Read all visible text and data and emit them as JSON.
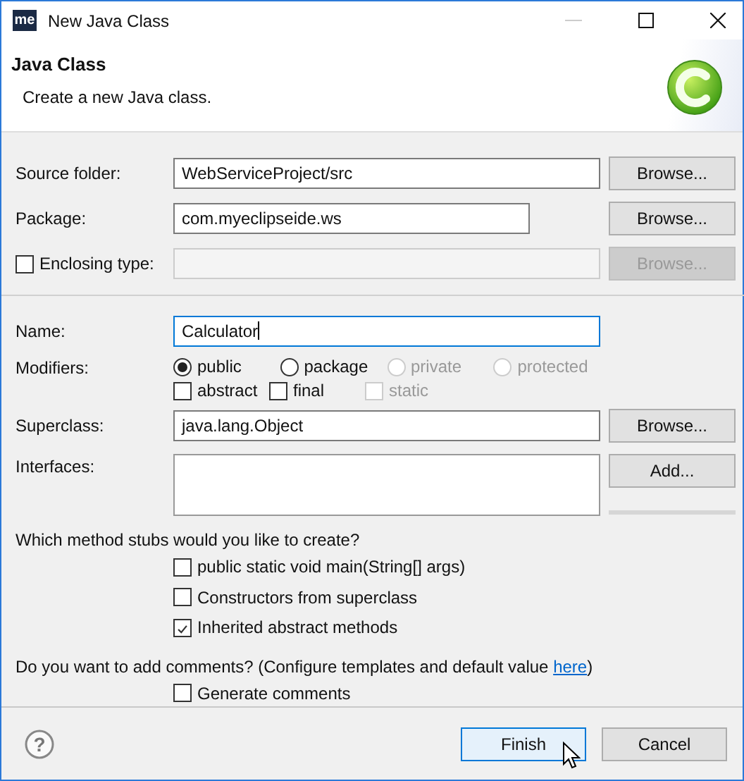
{
  "window": {
    "title": "New Java Class",
    "logo": "me"
  },
  "header": {
    "title": "Java Class",
    "subtitle": "Create a new Java class."
  },
  "location_fields": [
    {
      "kind": "text",
      "label": "Source folder:",
      "value": "WebServiceProject/src",
      "button": {
        "label": "Browse...",
        "disabled": false
      }
    },
    {
      "kind": "text",
      "label": "Package:",
      "value": "com.myeclipseide.ws",
      "button": {
        "label": "Browse...",
        "disabled": false
      }
    },
    {
      "kind": "checkbox-text",
      "label": "Enclosing type:",
      "checked": false,
      "disabled": true,
      "button": {
        "label": "Browse...",
        "disabled": true
      }
    }
  ],
  "name": {
    "label": "Name:",
    "value": "Calculator",
    "focused": true
  },
  "modifiers": {
    "label": "Modifiers:",
    "access": [
      {
        "label": "public",
        "selected": true,
        "disabled": false
      },
      {
        "label": "package",
        "selected": false,
        "disabled": false
      },
      {
        "label": "private",
        "selected": false,
        "disabled": true
      },
      {
        "label": "protected",
        "selected": false,
        "disabled": true
      }
    ],
    "flags": [
      {
        "label": "abstract",
        "checked": false,
        "disabled": false
      },
      {
        "label": "final",
        "checked": false,
        "disabled": false
      },
      {
        "label": "static",
        "checked": false,
        "disabled": true
      }
    ]
  },
  "superclass": {
    "label": "Superclass:",
    "value": "java.lang.Object",
    "button": "Browse..."
  },
  "interfaces": {
    "label": "Interfaces:",
    "button": "Add..."
  },
  "stubs": {
    "question": "Which method stubs would you like to create?",
    "options": [
      {
        "label": "public static void main(String[] args)",
        "checked": false
      },
      {
        "label": "Constructors from superclass",
        "checked": false
      },
      {
        "label": "Inherited abstract methods",
        "checked": true
      }
    ]
  },
  "comments": {
    "question": "Do you want to add comments? (Configure templates and default value ",
    "link": "here",
    "question_end": ")",
    "options": [
      {
        "label": "Generate comments",
        "checked": false
      }
    ]
  },
  "footer": {
    "help": "?",
    "buttons": [
      {
        "label": "Finish",
        "default": true
      },
      {
        "label": "Cancel",
        "default": false
      }
    ]
  }
}
